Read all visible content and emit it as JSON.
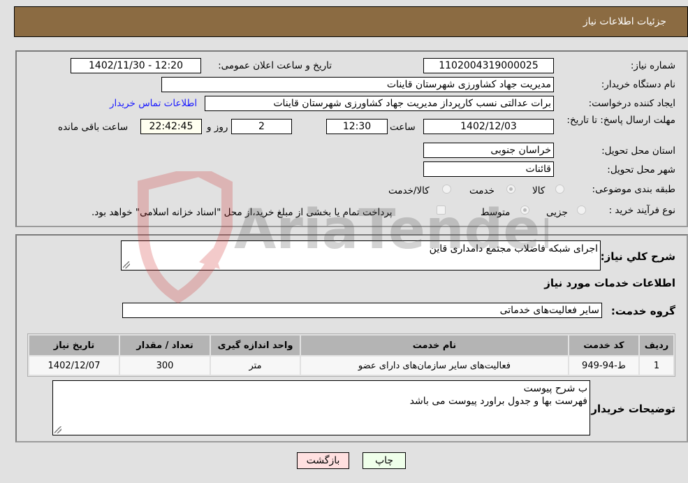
{
  "header": {
    "title": "جزئیات اطلاعات نیاز"
  },
  "details": {
    "need_number_label": "شماره نیاز:",
    "need_number": "1102004319000025",
    "announce_label": "تاریخ و ساعت اعلان عمومی:",
    "announce_value": "1402/11/30 - 12:20",
    "buyer_org_label": "نام دستگاه خریدار:",
    "buyer_org": "مدیریت جهاد کشاورزی شهرستان قاینات",
    "creator_label": "ایجاد کننده درخواست:",
    "creator": "برات عدالتی نسب کارپرداز مدیریت جهاد کشاورزی شهرستان قاینات",
    "contact_link": "اطلاعات تماس خریدار",
    "deadline_label": "مهلت ارسال پاسخ: تا تاریخ:",
    "deadline_date": "1402/12/03",
    "time_label": "ساعت",
    "deadline_time": "12:30",
    "days_value": "2",
    "days_label": "روز و",
    "remaining_time": "22:42:45",
    "remaining_label": "ساعت باقی مانده",
    "province_label": "استان محل تحویل:",
    "province": "خراسان جنوبی",
    "city_label": "شهر محل تحویل:",
    "city": "قائنات",
    "category_label": "طبقه بندی موضوعی:",
    "category_options": [
      "کالا",
      "خدمت",
      "کالا/خدمت"
    ],
    "category_selected": "خدمت",
    "process_label": "نوع فرآیند خرید :",
    "process_options": [
      "جزیی",
      "متوسط"
    ],
    "process_selected": "متوسط",
    "treasury_note": "پرداخت تمام یا بخشی از مبلغ خرید،از محل \"اسناد خزانه اسلامی\" خواهد بود."
  },
  "services": {
    "summary_label": "شرح کلي نیاز:",
    "summary_value": "اجرای شبکه فاضلاب مجتمع دامداری قاین",
    "section_title": "اطلاعات خدمات مورد نیاز",
    "group_label": "گروه خدمت:",
    "group_value": "سایر فعالیت‌های خدماتی",
    "table": {
      "headers": [
        "ردیف",
        "کد خدمت",
        "نام خدمت",
        "واحد اندازه گیری",
        "تعداد / مقدار",
        "تاریخ نیاز"
      ],
      "rows": [
        [
          "1",
          "ط-94-949",
          "فعالیت‌های سایر سازمان‌های دارای عضو",
          "متر",
          "300",
          "1402/12/07"
        ]
      ]
    },
    "buyer_notes_label": "توضیحات خریدار:",
    "buyer_notes_line1": "ب شرح پیوست",
    "buyer_notes_line2": "فهرست بها و جدول براورد پیوست می باشد"
  },
  "buttons": {
    "print": "چاپ",
    "back": "بازگشت"
  },
  "watermark": {
    "text": "AriaTender.neT"
  }
}
